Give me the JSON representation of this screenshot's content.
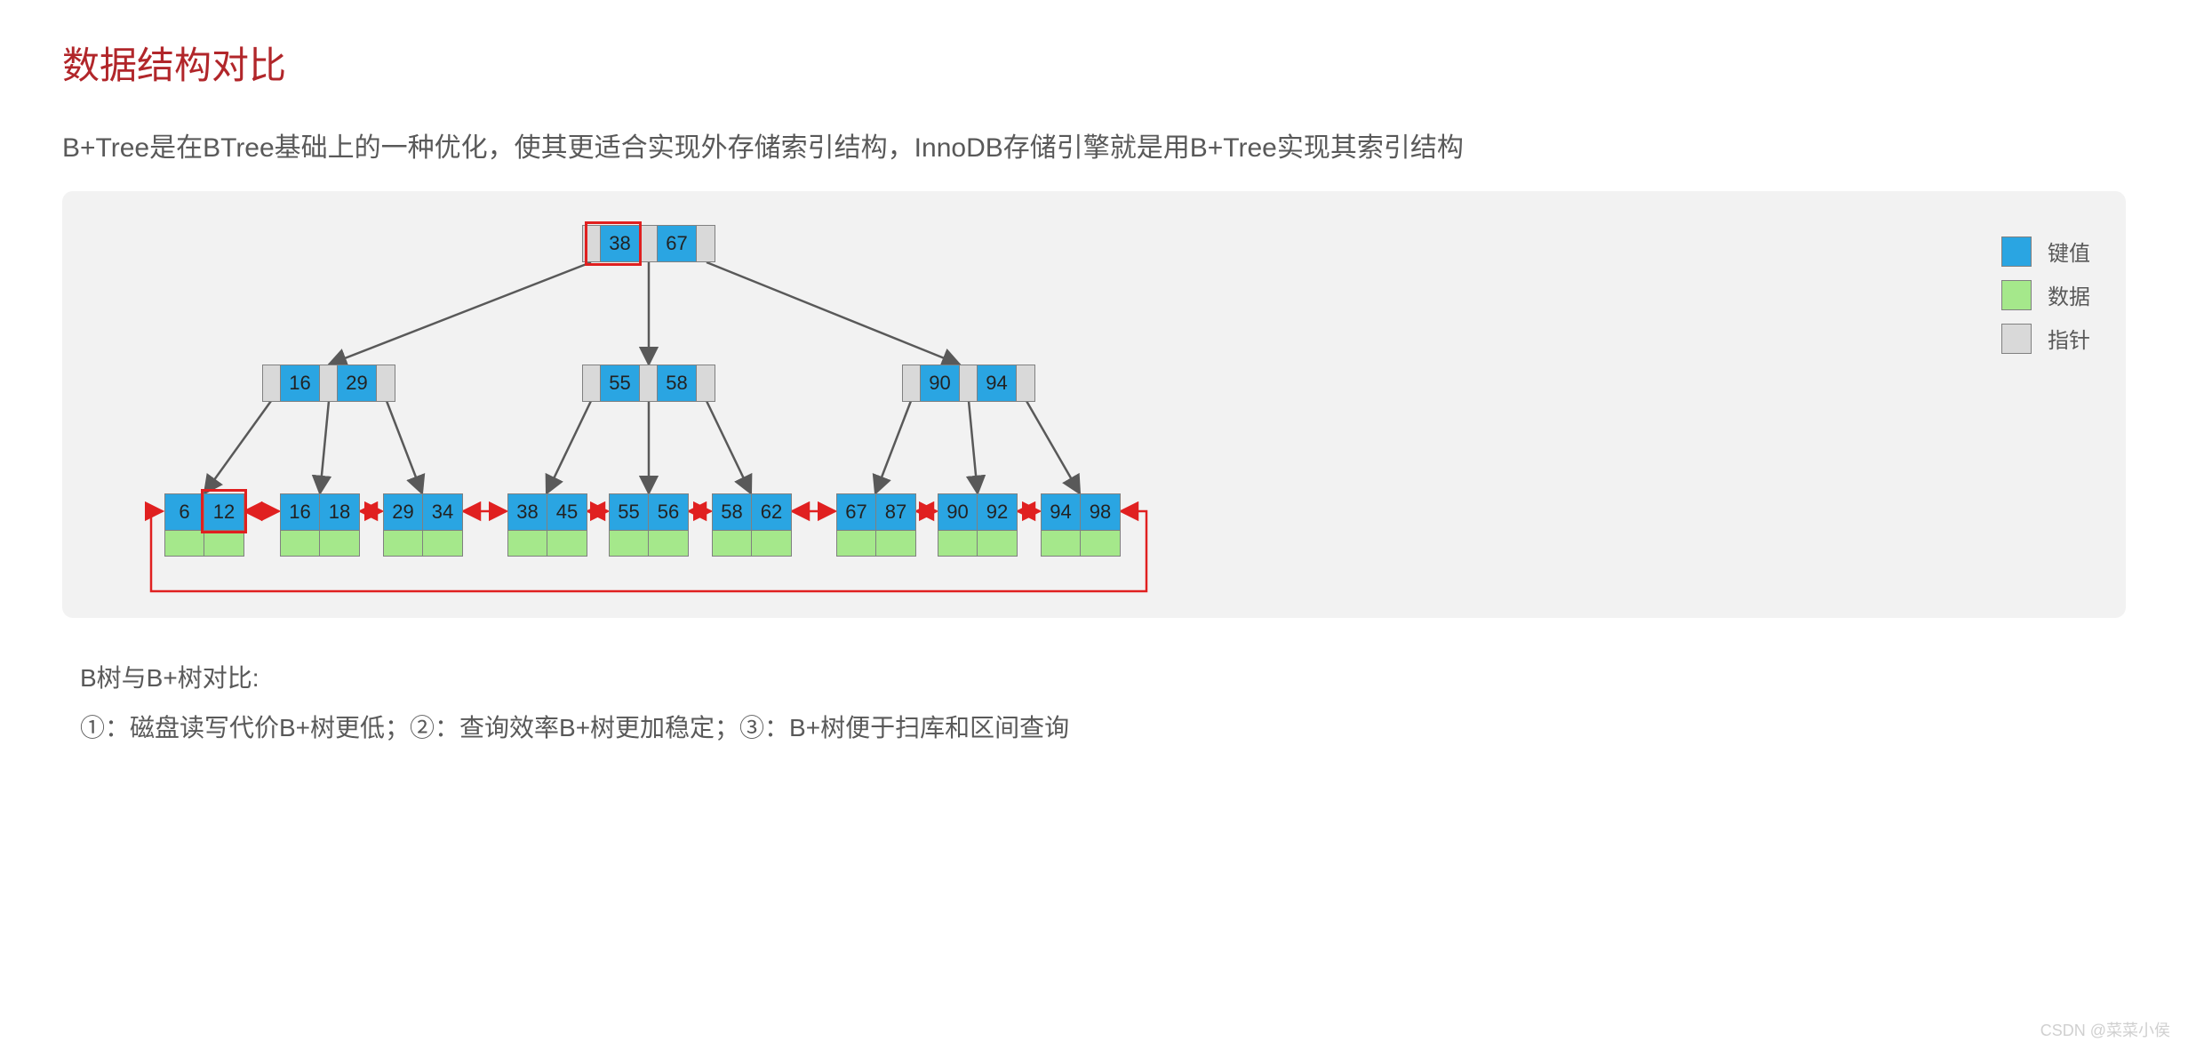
{
  "title": "数据结构对比",
  "subtitle": "B+Tree是在BTree基础上的一种优化，使其更适合实现外存储索引结构，InnoDB存储引擎就是用B+Tree实现其索引结构",
  "legend": {
    "key": "键值",
    "data": "数据",
    "ptr": "指针"
  },
  "footer_title": "B树与B+树对比:",
  "footer_points": "①：磁盘读写代价B+树更低；②：查询效率B+树更加稳定；③：B+树便于扫库和区间查询",
  "watermark": "CSDN @菜菜小侯",
  "chart_data": {
    "type": "tree",
    "description": "B+Tree structure with 3 levels, leaf nodes linked as doubly-linked list",
    "colors": {
      "key": "#2aa5e2",
      "data": "#a5e88b",
      "pointer": "#d9d9d9",
      "highlight": "#e02020"
    },
    "root": {
      "keys": [
        38,
        67
      ],
      "highlighted_key_index": 0
    },
    "internal": [
      {
        "keys": [
          16,
          29
        ]
      },
      {
        "keys": [
          55,
          58
        ]
      },
      {
        "keys": [
          90,
          94
        ]
      }
    ],
    "leaves": [
      {
        "keys": [
          6,
          12
        ],
        "highlighted_key_index": 1
      },
      {
        "keys": [
          16,
          18
        ]
      },
      {
        "keys": [
          29,
          34
        ]
      },
      {
        "keys": [
          38,
          45
        ]
      },
      {
        "keys": [
          55,
          56
        ]
      },
      {
        "keys": [
          58,
          62
        ]
      },
      {
        "keys": [
          67,
          87
        ]
      },
      {
        "keys": [
          90,
          92
        ]
      },
      {
        "keys": [
          94,
          98
        ]
      }
    ],
    "leaf_links": "bidirectional red arrows between consecutive leaves, plus wrap-around link from last leaf back to first"
  }
}
